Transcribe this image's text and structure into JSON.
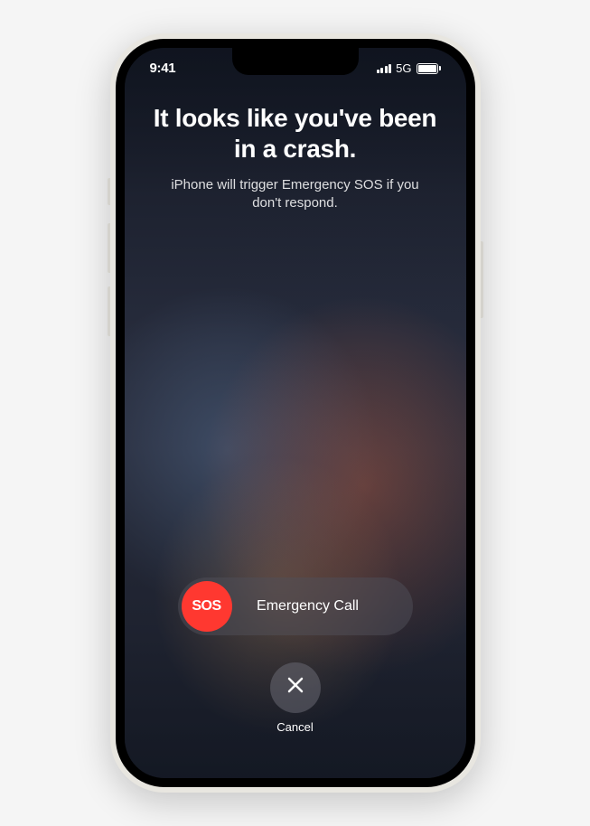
{
  "status": {
    "time": "9:41",
    "network": "5G"
  },
  "alert": {
    "headline": "It looks like you've been in a crash.",
    "subtext": "iPhone will trigger Emergency SOS if you don't respond."
  },
  "sos": {
    "knob_label": "SOS",
    "slider_label": "Emergency Call"
  },
  "cancel": {
    "label": "Cancel"
  }
}
